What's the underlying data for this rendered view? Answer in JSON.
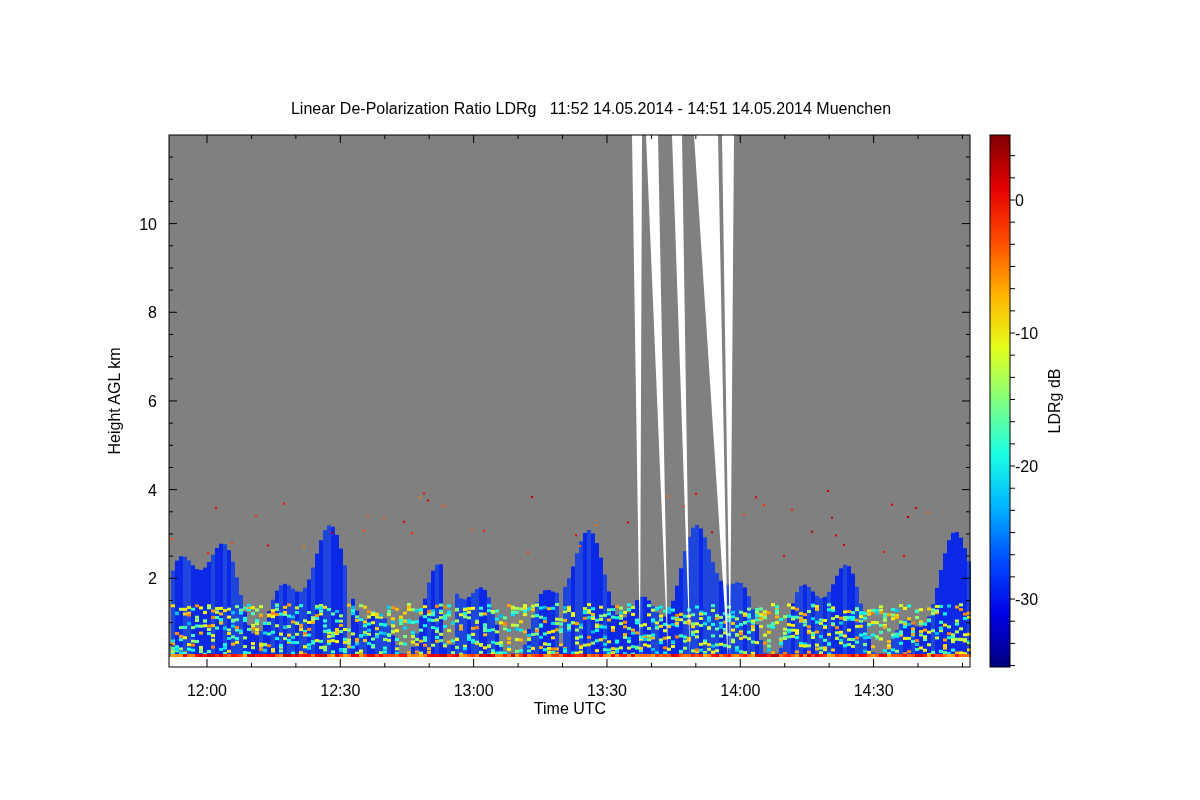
{
  "title": "Linear De-Polarization Ratio LDRg   11:52 14.05.2014 - 14:51 14.05.2014 Muenchen",
  "plot": {
    "xlabel": "Time UTC",
    "ylabel": "Height AGL km",
    "xticks": [
      "12:00",
      "12:30",
      "13:00",
      "13:30",
      "14:00",
      "14:30"
    ],
    "yticks": [
      "10",
      "8",
      "6",
      "4",
      "2"
    ]
  },
  "colorbar": {
    "label": "LDRg dB",
    "ticks": [
      "0",
      "-10",
      "-20",
      "-30"
    ]
  }
}
